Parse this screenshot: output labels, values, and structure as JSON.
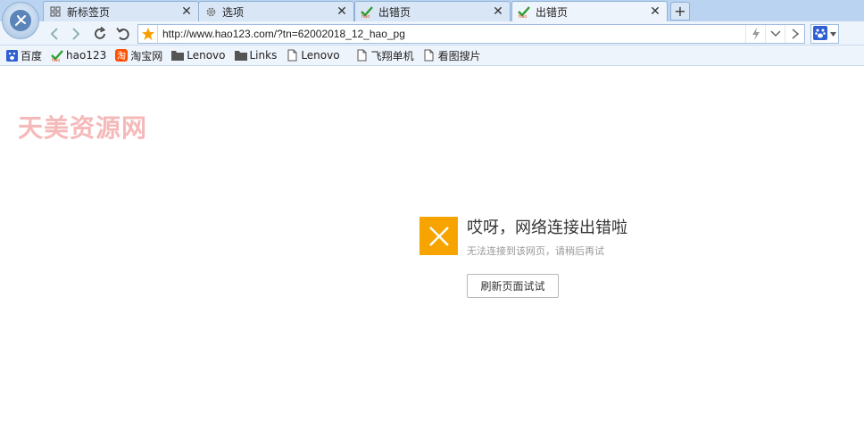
{
  "tabs": [
    {
      "label": "新标签页",
      "icon": "grid-icon"
    },
    {
      "label": "选项",
      "icon": "gear-icon"
    },
    {
      "label": "出错页",
      "icon": "hao-check-icon"
    },
    {
      "label": "出错页",
      "icon": "hao-check-icon",
      "active": true
    }
  ],
  "toolbar": {
    "url": "http://www.hao123.com/?tn=62002018_12_hao_pg"
  },
  "bookmarks": [
    {
      "label": "百度",
      "icon": "baidu-paw-icon"
    },
    {
      "label": "hao123",
      "icon": "hao-check-icon"
    },
    {
      "label": "淘宝网",
      "icon": "taobao-icon"
    },
    {
      "label": "Lenovo",
      "icon": "folder-icon"
    },
    {
      "label": "Links",
      "icon": "folder-icon"
    },
    {
      "label": "Lenovo",
      "icon": "page-icon"
    },
    {
      "label": "飞翔单机",
      "icon": "page-icon"
    },
    {
      "label": "看图搜片",
      "icon": "page-icon"
    }
  ],
  "watermark": "天美资源网",
  "error": {
    "title": "哎呀，网络连接出错啦",
    "subtitle": "无法连接到该网页，请稍后再试",
    "button": "刷新页面试试"
  },
  "colors": {
    "accent": "#f7a400",
    "chrome": "#b9d3f0",
    "toolbar": "#eef4fc",
    "watermark": "#f6b9b9"
  }
}
